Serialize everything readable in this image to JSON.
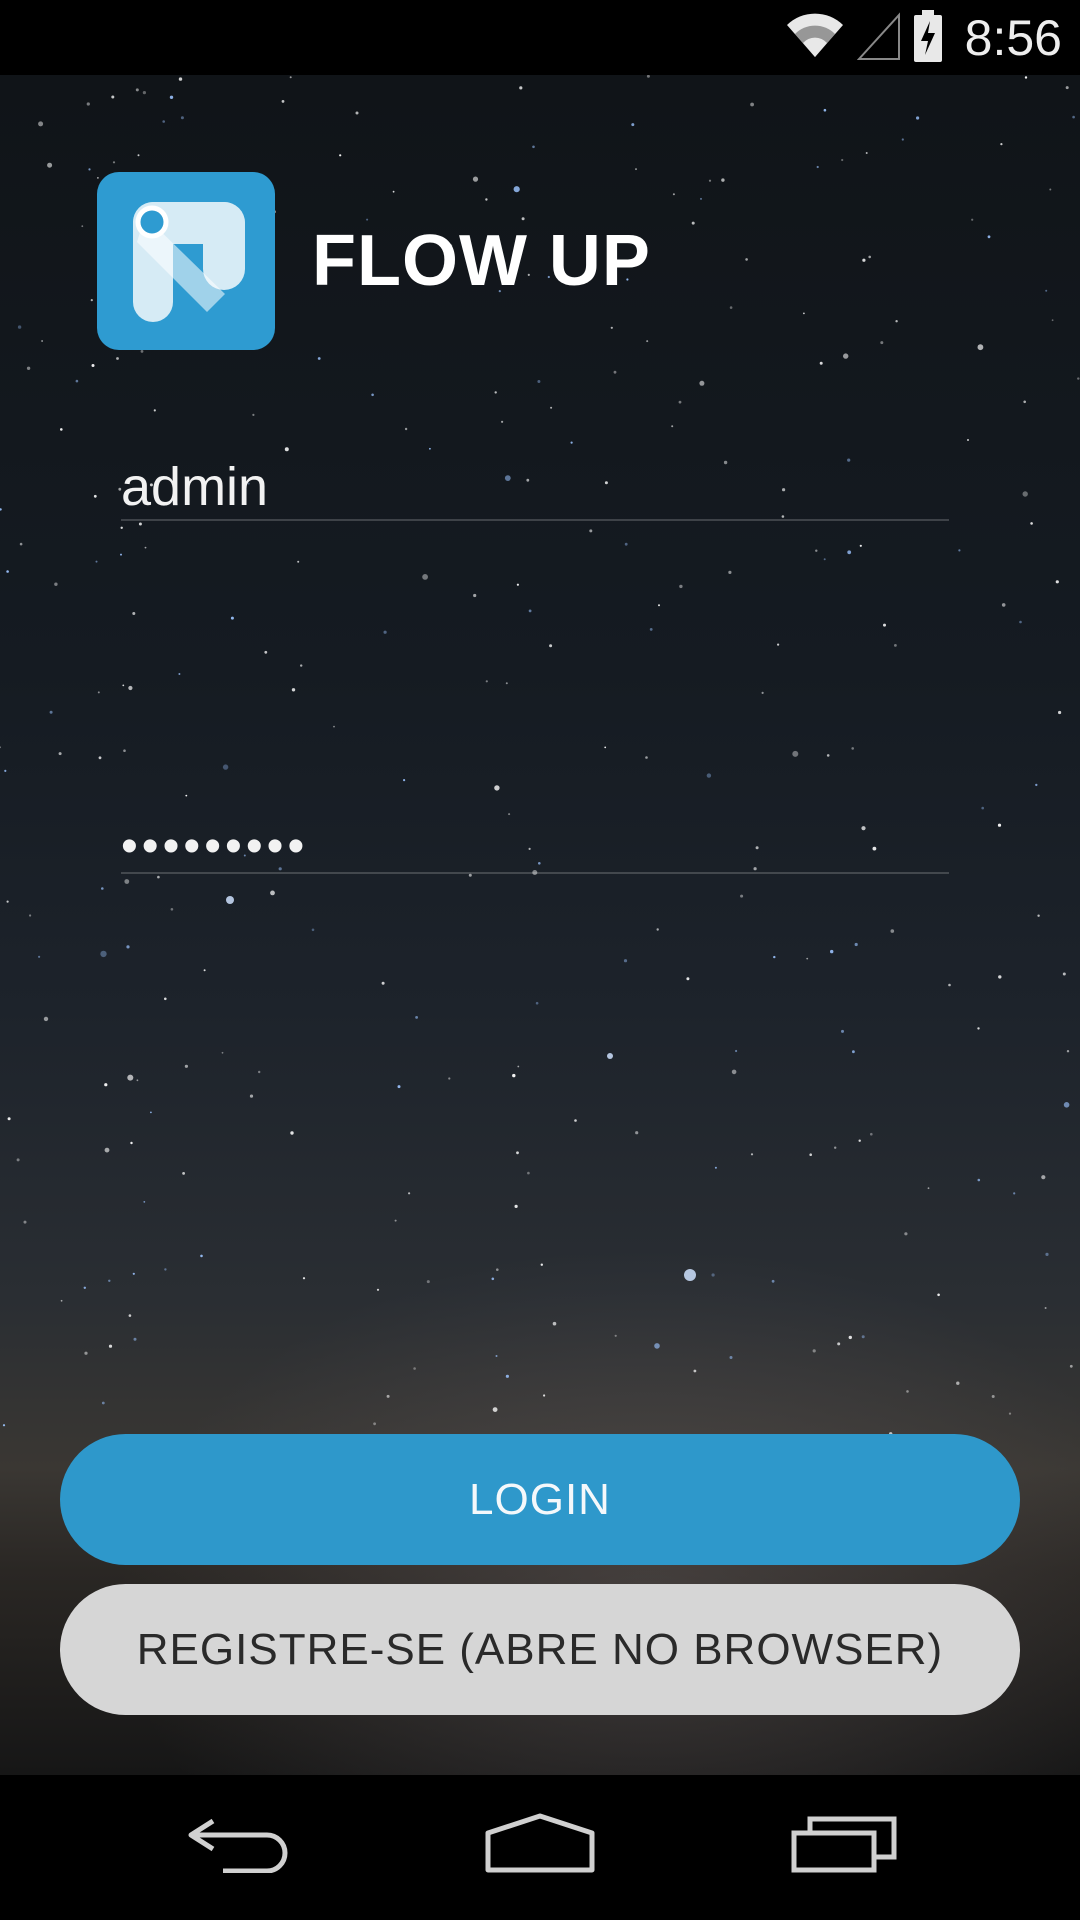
{
  "status_bar": {
    "time": "8:56",
    "icons": [
      "wifi-icon",
      "cell-signal-icon",
      "battery-charging-icon"
    ]
  },
  "header": {
    "app_name": "FLOW UP",
    "logo_icon": "flow-up-logo",
    "logo_color": "#2e9bd1"
  },
  "form": {
    "username_value": "admin",
    "password_value": "•••••••••"
  },
  "buttons": {
    "login_label": "LOGIN",
    "register_label": "REGISTRE-SE (ABRE NO BROWSER)",
    "login_color": "#2e98cb",
    "register_color": "#d6d6d6"
  },
  "nav_bar": {
    "items": [
      "back-icon",
      "home-icon",
      "recent-apps-icon"
    ]
  }
}
